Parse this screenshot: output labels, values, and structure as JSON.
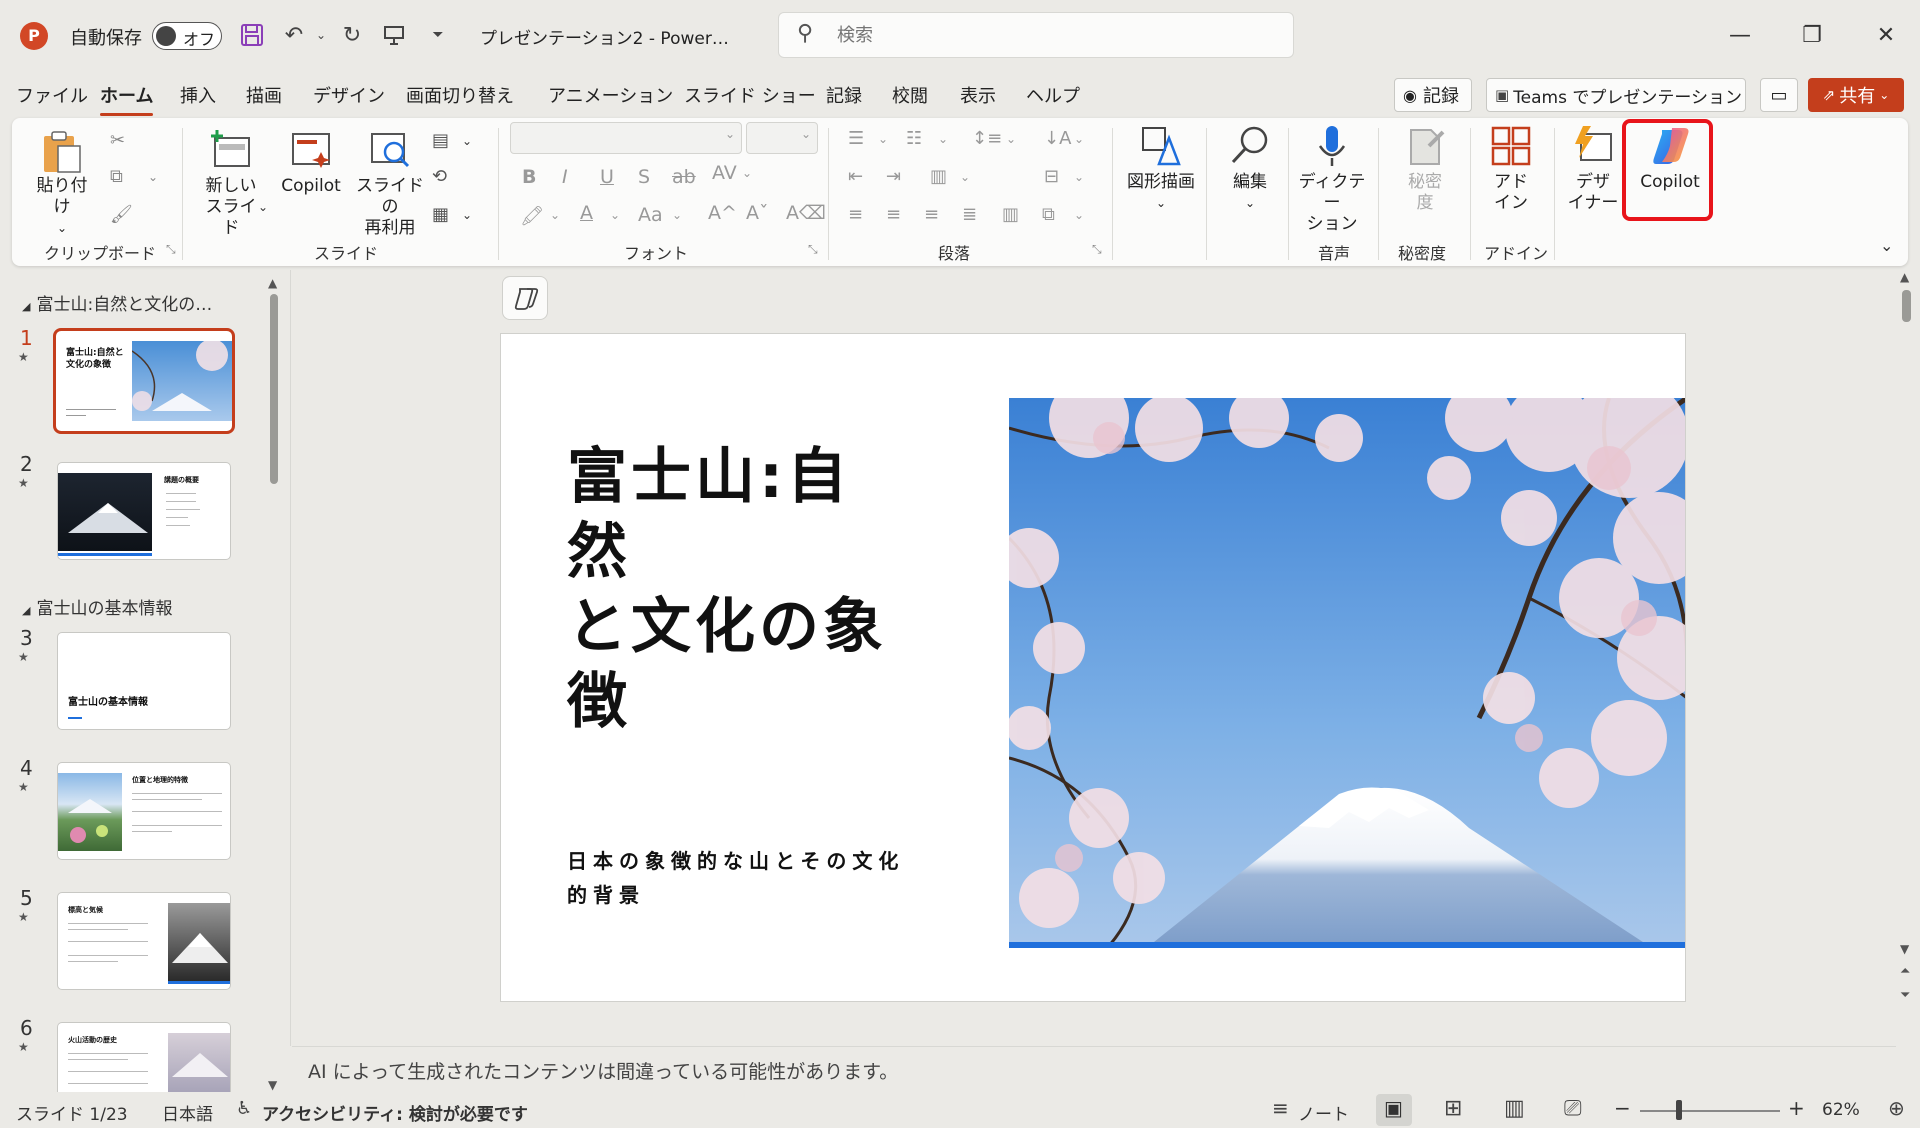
{
  "titlebar": {
    "autosave_label": "自動保存",
    "autosave_state": "オフ",
    "doc_title": "プレゼンテーション2  -  Power…",
    "search_placeholder": "検索"
  },
  "menu": {
    "tabs": [
      "ファイル",
      "ホーム",
      "挿入",
      "描画",
      "デザイン",
      "画面切り替え",
      "アニメーション",
      "スライド ショー",
      "記録",
      "校閲",
      "表示",
      "ヘルプ"
    ],
    "active_tab": "ホーム",
    "record_btn": "記録",
    "teams_btn": "Teams でプレゼンテーション",
    "share_btn": "共有"
  },
  "ribbon": {
    "paste": "貼り付け",
    "clipboard_group": "クリップボード",
    "new_slide": [
      "新しい",
      "スライド"
    ],
    "copilot_small": "Copilot",
    "reuse_slide": [
      "スライドの",
      "再利用"
    ],
    "slides_group": "スライド",
    "font_group": "フォント",
    "paragraph_group": "段落",
    "shapes": "図形描画",
    "edit": "編集",
    "dictate": [
      "ディクテー",
      "ション"
    ],
    "voice_group": "音声",
    "sensitivity": [
      "秘密",
      "度"
    ],
    "sensitivity_group": "秘密度",
    "addin": [
      "アド",
      "イン"
    ],
    "addin_group": "アドイン",
    "designer": [
      "デザ",
      "イナー"
    ],
    "copilot_big": "Copilot"
  },
  "sections": [
    {
      "name": "富士山:自然と文化の…"
    },
    {
      "name": "富士山の基本情報"
    }
  ],
  "slides": [
    {
      "num": "1",
      "title": "富士山:自然と文化の象徴",
      "sub": "日本の象徴的な山とその文化的背景"
    },
    {
      "num": "2",
      "title": "講題の概要"
    },
    {
      "num": "3",
      "title": "富士山の基本情報"
    },
    {
      "num": "4",
      "title": "位置と地理的特徴"
    },
    {
      "num": "5",
      "title": "標高と気候"
    },
    {
      "num": "6",
      "title": "火山活動の歴史"
    }
  ],
  "main_slide": {
    "title": "富士山:自然と文化の象徴",
    "title_lines": [
      "富士山:自然",
      "と文化の象",
      "徴"
    ],
    "subtitle_lines": [
      "日本の象徴的な山とその文化",
      "的背景"
    ]
  },
  "notes": "AI によって生成されたコンテンツは間違っている可能性があります。",
  "status": {
    "slide_counter": "スライド 1/23",
    "language": "日本語",
    "accessibility": "アクセシビリティ: 検討が必要です",
    "notes_btn": "ノート",
    "zoom": "62%"
  },
  "colors": {
    "accent": "#c43e1c",
    "highlight_box": "#e8141a",
    "slide_blue": "#1f6fdc"
  }
}
